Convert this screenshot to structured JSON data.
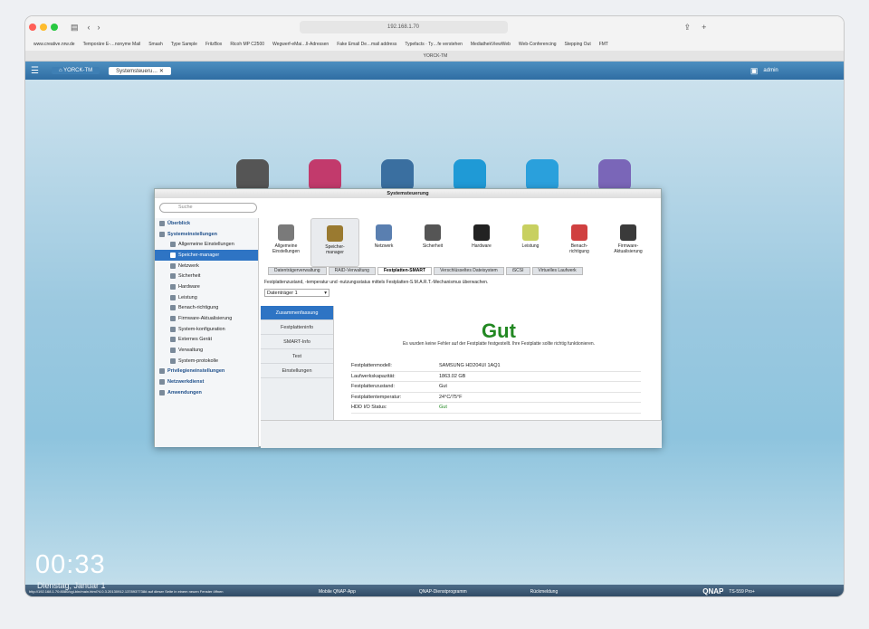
{
  "browser": {
    "url": "192.168.1.70",
    "tab_title": "YORCK-TM",
    "bookmarks": [
      "www.creative.nrw.de",
      "Temporäre E-…nonyme Mail",
      "Smash",
      "Type Sample",
      "FritzBox",
      "Ricoh MP C2500",
      "Wegwerf-eMai…ll-Adressen",
      "Fake Email De…mail address",
      "Typefacts · Ty…fe verstehen",
      "MediathekViewWeb",
      "Web-Conferencing",
      "Stepping Out",
      "FMT"
    ]
  },
  "qnap": {
    "host_label": "YORCK-TM",
    "open_window": "Systemsteueru…",
    "user": "admin",
    "brand": "QNAP",
    "model": "TS-559 Pro+",
    "taskbar_items": [
      "Mobile QNAP-App",
      "QNAP-Dienstprogramm",
      "Rückmeldung"
    ],
    "status_url": "http://192.168.1.70:8080/cgi-bin/main.html?4.0.3.20130912.1378937738# auf dieser Seite in einem neuen Fenster öffnen",
    "clock": "00:33",
    "date": "Dienstag, Januar 1"
  },
  "syscontrol": {
    "title": "Systemsteuerung",
    "search_placeholder": "Suche",
    "sidebar": [
      {
        "label": "Überblick",
        "level": 0
      },
      {
        "label": "Systemeinstellungen",
        "level": 0
      },
      {
        "label": "Allgemeine Einstellungen",
        "level": 1
      },
      {
        "label": "Speicher-manager",
        "level": 1,
        "selected": true
      },
      {
        "label": "Netzwerk",
        "level": 1
      },
      {
        "label": "Sicherheit",
        "level": 1
      },
      {
        "label": "Hardware",
        "level": 1
      },
      {
        "label": "Leistung",
        "level": 1
      },
      {
        "label": "Benach-richtigung",
        "level": 1
      },
      {
        "label": "Firmware-Aktualisierung",
        "level": 1
      },
      {
        "label": "System-konfiguration",
        "level": 1
      },
      {
        "label": "Externes Gerät",
        "level": 1
      },
      {
        "label": "Verwaltung",
        "level": 1
      },
      {
        "label": "System-protokolle",
        "level": 1
      },
      {
        "label": "Privilegieneinstellungen",
        "level": 0
      },
      {
        "label": "Netzwerkdienst",
        "level": 0
      },
      {
        "label": "Anwendungen",
        "level": 0
      }
    ],
    "top_icons": [
      {
        "label1": "Allgemeine",
        "label2": "Einstellungen",
        "color": "#7a7a7a"
      },
      {
        "label1": "Speicher-",
        "label2": "manager",
        "color": "#9a7a30",
        "selected": true
      },
      {
        "label1": "Netzwerk",
        "label2": "",
        "color": "#5a7fb0"
      },
      {
        "label1": "Sicherheit",
        "label2": "",
        "color": "#555555"
      },
      {
        "label1": "Hardware",
        "label2": "",
        "color": "#222222"
      },
      {
        "label1": "Leistung",
        "label2": "",
        "color": "#c8d060"
      },
      {
        "label1": "Benach-",
        "label2": "richtigung",
        "color": "#d04040"
      },
      {
        "label1": "Firmware-",
        "label2": "Aktualisierung",
        "color": "#3a3a3a"
      }
    ],
    "tabs": [
      "Datenträgerverwaltung",
      "RAID-Verwaltung",
      "Festplatten-SMART",
      "Verschlüsseltes Dateisystem",
      "iSCSI",
      "Virtuelles Laufwerk"
    ],
    "active_tab": "Festplatten-SMART",
    "description": "Festplattenzustand, -temperatur und -nutzungsstatus mittels Festplatten-S.M.A.R.T.-Mechanismus überwachen.",
    "disk_select": "Datenträger 1",
    "subnav": [
      "Zusammenfassung",
      "Festplatteninfo",
      "SMART-Info",
      "Test",
      "Einstellungen"
    ],
    "status_big": "Gut",
    "status_msg": "Es wurden keine Fehler auf der Festplatte festgestellt. Ihre Festplatte sollte richtig funktionieren.",
    "info": [
      {
        "k": "Festplattenmodell:",
        "v": "SAMSUNG HD204UI 1AQ1"
      },
      {
        "k": "Laufwerkskapazität:",
        "v": "1863.02 GB"
      },
      {
        "k": "Festplattenzustand:",
        "v": "Gut"
      },
      {
        "k": "Festplattentemperatur:",
        "v": "24°C/75°F"
      },
      {
        "k": "HDD I/O Status:",
        "v": "Gut",
        "green": true
      }
    ]
  },
  "colors": {
    "accent": "#2e74c4",
    "good": "#228822",
    "desktop": "#9cc9e0"
  }
}
